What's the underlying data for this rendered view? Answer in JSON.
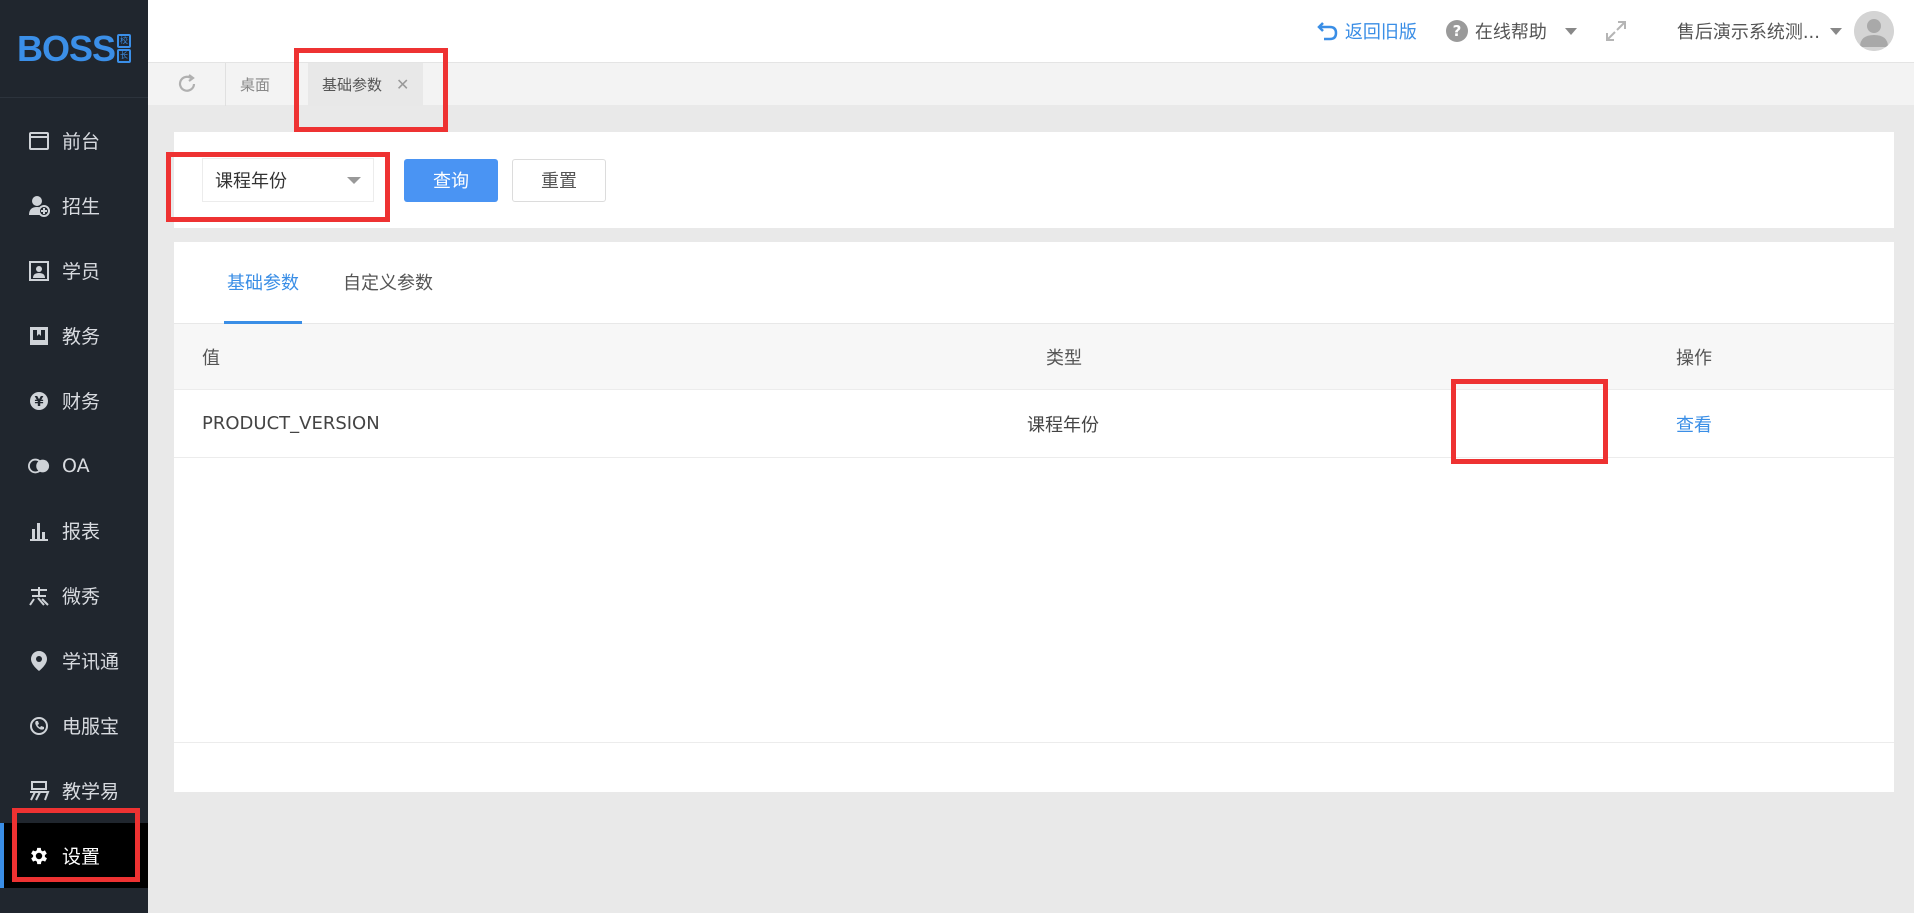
{
  "sidebar": {
    "logo": "BOSS",
    "logo_badge": [
      "校",
      "长"
    ],
    "items": [
      {
        "label": "前台",
        "icon": "window-icon"
      },
      {
        "label": "招生",
        "icon": "user-add-icon"
      },
      {
        "label": "学员",
        "icon": "id-card-icon"
      },
      {
        "label": "教务",
        "icon": "book-icon"
      },
      {
        "label": "财务",
        "icon": "yen-icon"
      },
      {
        "label": "OA",
        "icon": "chat-icon"
      },
      {
        "label": "报表",
        "icon": "bar-chart-icon"
      },
      {
        "label": "微秀",
        "icon": "xiu-icon"
      },
      {
        "label": "学讯通",
        "icon": "location-icon"
      },
      {
        "label": "电服宝",
        "icon": "phone-icon"
      },
      {
        "label": "教学易",
        "icon": "yi-icon"
      },
      {
        "label": "设置",
        "icon": "gear-icon",
        "active": true
      }
    ]
  },
  "header": {
    "back_label": "返回旧版",
    "help_label": "在线帮助",
    "user_name": "售后演示系统测..."
  },
  "page_tabs": {
    "desk": "桌面",
    "current": "基础参数"
  },
  "filter": {
    "type_value": "课程年份",
    "query_label": "查询",
    "reset_label": "重置"
  },
  "panel": {
    "tabs": [
      "基础参数",
      "自定义参数"
    ],
    "columns": [
      "值",
      "类型",
      "操作"
    ],
    "rows": [
      {
        "value": "PRODUCT_VERSION",
        "type": "课程年份",
        "action": "查看"
      }
    ]
  },
  "colors": {
    "accent": "#3a8ee6",
    "sidebar_bg": "#20262e",
    "highlight": "#ee3232"
  }
}
